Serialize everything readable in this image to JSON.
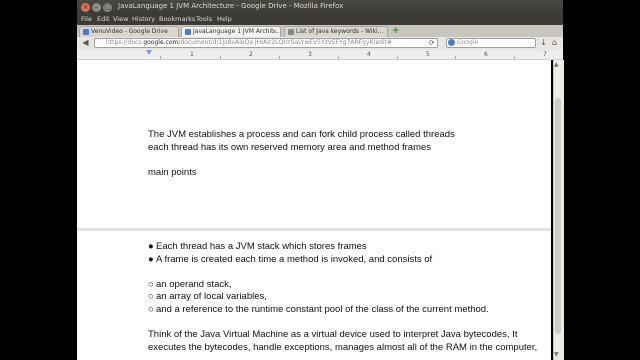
{
  "window": {
    "title": "JavaLanguage 1 JVM Architecture - Google Drive - Mozilla Firefox",
    "controls": [
      "×",
      "–",
      "□"
    ]
  },
  "menubar": [
    "File",
    "Edit",
    "View",
    "History",
    "Bookmarks",
    "Tools",
    "Help"
  ],
  "tabs": [
    {
      "label": "VenuVideo - Google Drive",
      "active": false
    },
    {
      "label": "JavaLanguage 1 JVM Archit...",
      "active": true
    },
    {
      "label": "List of Java keywords - Wiki...",
      "active": false
    }
  ],
  "navbar": {
    "url_prefix": "https://docs.",
    "url_domain": "google.com",
    "url_rest": "/document/d/1Jo8xAleQa JHIAIr2LQhYSaLYwEV5YzVEFYg7ARFgyK/edit#",
    "search_placeholder": "Google"
  },
  "ruler": [
    "1",
    "2",
    "3",
    "4",
    "5",
    "6",
    "7"
  ],
  "document": {
    "line1": "The JVM establishes a process and can fork child process called threads",
    "line2": "each thread has its own reserved memory area and method frames",
    "heading": "main points",
    "bullet1": "Each thread has a JVM stack which stores frames",
    "bullet2": "A frame is created each time a method is invoked, and consists of",
    "sub1": "an operand stack,",
    "sub2": "an array of local variables,",
    "sub3": "and a reference to the runtime constant pool of the class of the current method.",
    "para1": "Think of the Java Virtual Machine as a virtual device used to interpret Java bytecodes, It",
    "para2": "executes the bytecodes, handle exceptions, manages almost all of the RAM in the computer,",
    "bullet_char": "●",
    "sub_char": "○"
  }
}
